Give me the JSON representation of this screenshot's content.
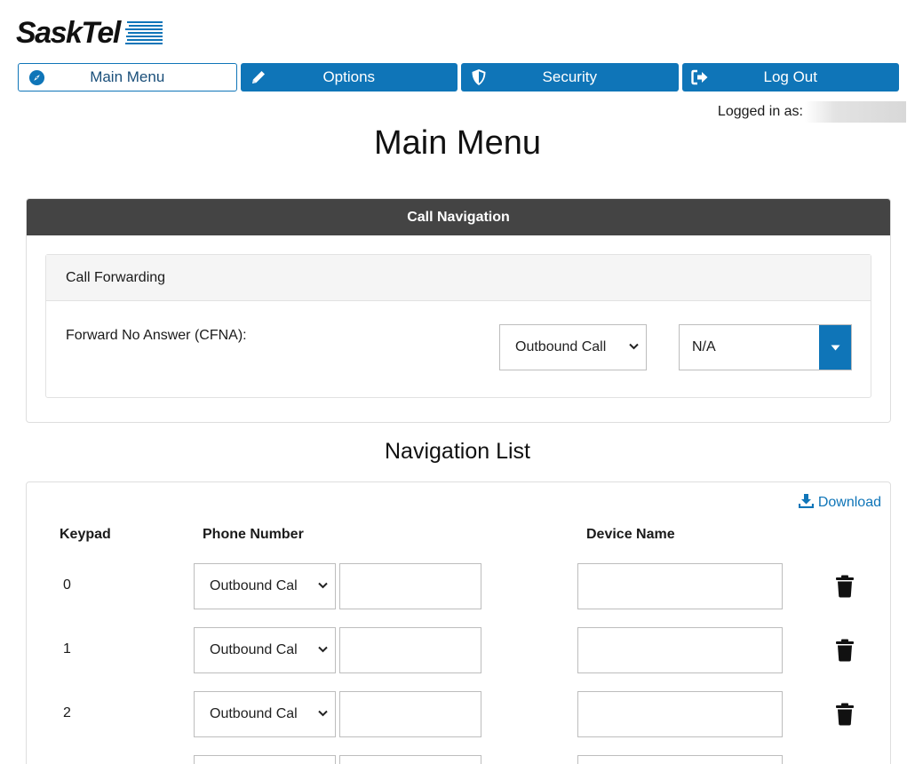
{
  "brand": {
    "name": "SaskTel",
    "color": "#0f75b8"
  },
  "nav": [
    {
      "label": "Main Menu",
      "icon": "compass-icon",
      "active": true
    },
    {
      "label": "Options",
      "icon": "pencil-icon",
      "active": false
    },
    {
      "label": "Security",
      "icon": "shield-icon",
      "active": false
    },
    {
      "label": "Log Out",
      "icon": "sign-out-icon",
      "active": false
    }
  ],
  "logged_in_label": "Logged in as:",
  "page_title": "Main Menu",
  "call_navigation": {
    "header": "Call Navigation",
    "forwarding_title": "Call Forwarding",
    "cfna_label": "Forward No Answer (CFNA):",
    "cfna_type": "Outbound Call",
    "cfna_target": "N/A"
  },
  "navigation_list": {
    "title": "Navigation List",
    "download_label": "Download",
    "columns": {
      "keypad": "Keypad",
      "phone": "Phone Number",
      "device": "Device Name"
    },
    "rows": [
      {
        "key": "0",
        "type": "Outbound Cal",
        "phone": "",
        "device": ""
      },
      {
        "key": "1",
        "type": "Outbound Cal",
        "phone": "",
        "device": ""
      },
      {
        "key": "2",
        "type": "Outbound Cal",
        "phone": "",
        "device": ""
      },
      {
        "key": "",
        "type": "",
        "phone": "",
        "device": ""
      }
    ]
  }
}
